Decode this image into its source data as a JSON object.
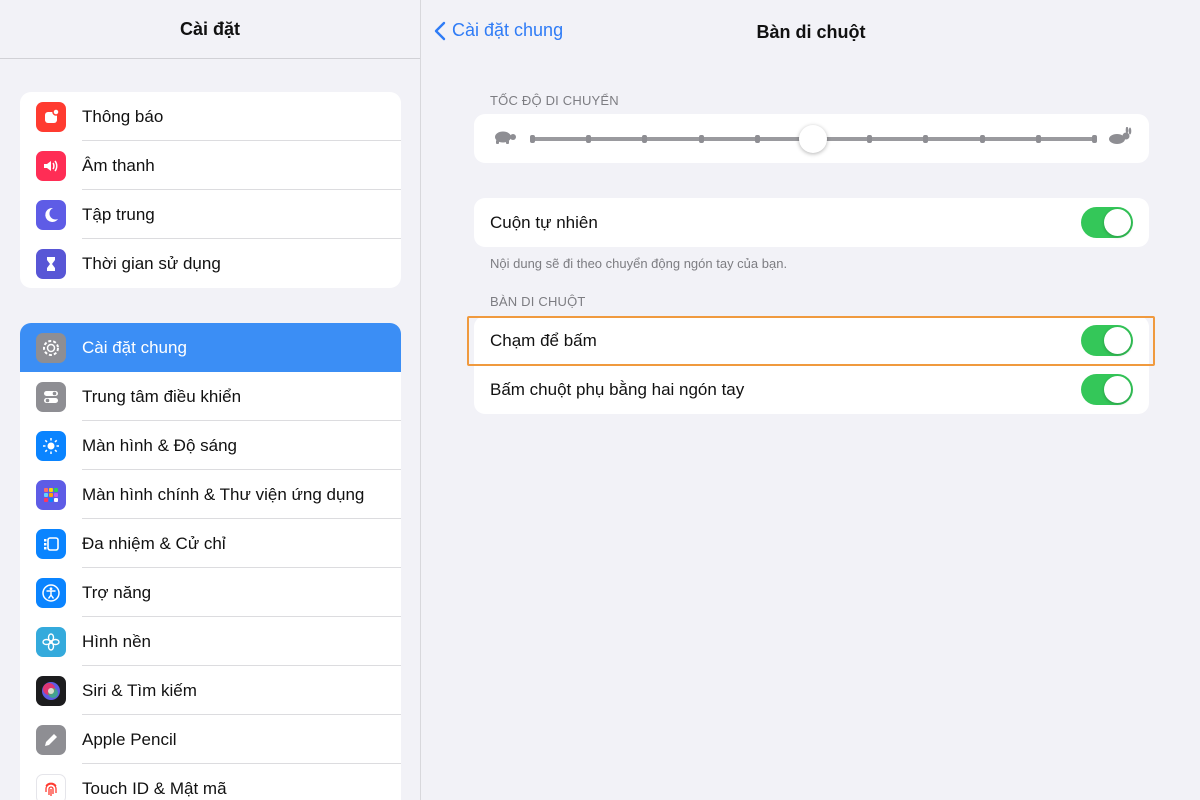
{
  "sidebar": {
    "title": "Cài đặt",
    "group1": [
      {
        "label": "Thông báo",
        "icon": "bell-icon",
        "color": "#ff3b30"
      },
      {
        "label": "Âm thanh",
        "icon": "speaker-icon",
        "color": "#ff2d55"
      },
      {
        "label": "Tập trung",
        "icon": "moon-icon",
        "color": "#5e5ce6"
      },
      {
        "label": "Thời gian sử dụng",
        "icon": "hourglass-icon",
        "color": "#5856d6"
      }
    ],
    "group2": [
      {
        "label": "Cài đặt chung",
        "icon": "gear-icon",
        "color": "#8e8e93",
        "selected": true
      },
      {
        "label": "Trung tâm điều khiển",
        "icon": "switches-icon",
        "color": "#8e8e93"
      },
      {
        "label": "Màn hình & Độ sáng",
        "icon": "sun-icon",
        "color": "#0a84ff"
      },
      {
        "label": "Màn hình chính & Thư viện ứng dụng",
        "icon": "grid-icon",
        "color": "#5e5ce6"
      },
      {
        "label": "Đa nhiệm & Cử chỉ",
        "icon": "multitask-icon",
        "color": "#0a84ff"
      },
      {
        "label": "Trợ năng",
        "icon": "accessibility-icon",
        "color": "#0a84ff"
      },
      {
        "label": "Hình nền",
        "icon": "flower-icon",
        "color": "#34aadc"
      },
      {
        "label": "Siri & Tìm kiếm",
        "icon": "siri-icon",
        "color": "#1c1c1e"
      },
      {
        "label": "Apple Pencil",
        "icon": "pencil-icon",
        "color": "#8e8e93"
      },
      {
        "label": "Touch ID & Mật mã",
        "icon": "fingerprint-icon",
        "color": "#ff3b30"
      }
    ]
  },
  "detail": {
    "back_label": "Cài đặt chung",
    "title": "Bàn di chuột",
    "speed_section": "TỐC ĐỘ DI CHUYỂN",
    "speed_value": 0.5,
    "speed_steps": 10,
    "natural_scroll": {
      "label": "Cuộn tự nhiên",
      "on": true
    },
    "natural_scroll_note": "Nội dung sẽ đi theo chuyển động ngón tay của bạn.",
    "trackpad_section": "BÀN DI CHUỘT",
    "tap_to_click": {
      "label": "Chạm để bấm",
      "on": true
    },
    "two_finger_click": {
      "label": "Bấm chuột phụ bằng hai ngón tay",
      "on": true
    }
  },
  "colors": {
    "accent": "#2f7cf6",
    "toggle_on": "#34c759",
    "highlight": "#f09a3e"
  }
}
